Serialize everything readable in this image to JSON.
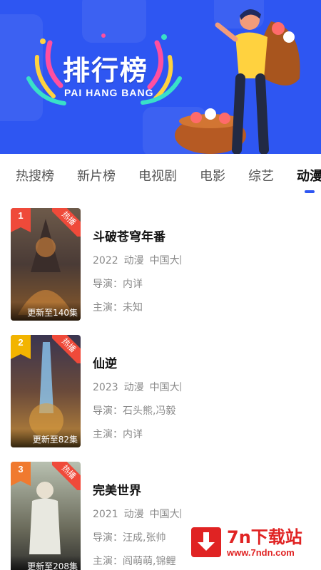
{
  "banner": {
    "title": "排行榜",
    "subtitle": "PAI HANG BANG"
  },
  "tabs": [
    {
      "label": "热搜榜",
      "active": false
    },
    {
      "label": "新片榜",
      "active": false
    },
    {
      "label": "电视剧",
      "active": false
    },
    {
      "label": "电影",
      "active": false
    },
    {
      "label": "综艺",
      "active": false
    },
    {
      "label": "动漫",
      "active": true
    }
  ],
  "items": [
    {
      "rank": "1",
      "badge": "热播",
      "update": "更新至140集",
      "title": "斗破苍穹年番",
      "year": "2022",
      "genre": "动漫",
      "region": "中国大陆",
      "director": "导演：内详",
      "cast": "主演：未知",
      "rank_color": "#ef4a3a"
    },
    {
      "rank": "2",
      "badge": "热播",
      "update": "更新至82集",
      "title": "仙逆",
      "year": "2023",
      "genre": "动漫",
      "region": "中国大陆",
      "director": "导演：石头熊,冯毅",
      "cast": "主演：内详",
      "rank_color": "#f2b400"
    },
    {
      "rank": "3",
      "badge": "热播",
      "update": "更新至208集",
      "title": "完美世界",
      "year": "2021",
      "genre": "动漫",
      "region": "中国大陆",
      "director": "导演：汪成,张帅",
      "cast": "主演：阎萌萌,锦鲤",
      "rank_color": "#f07a2f"
    }
  ],
  "watermark": {
    "name": "7n下载站",
    "url": "www.7ndn.com"
  },
  "colors": {
    "brand_blue": "#2e56f2",
    "hot_red": "#ef4a3a"
  }
}
